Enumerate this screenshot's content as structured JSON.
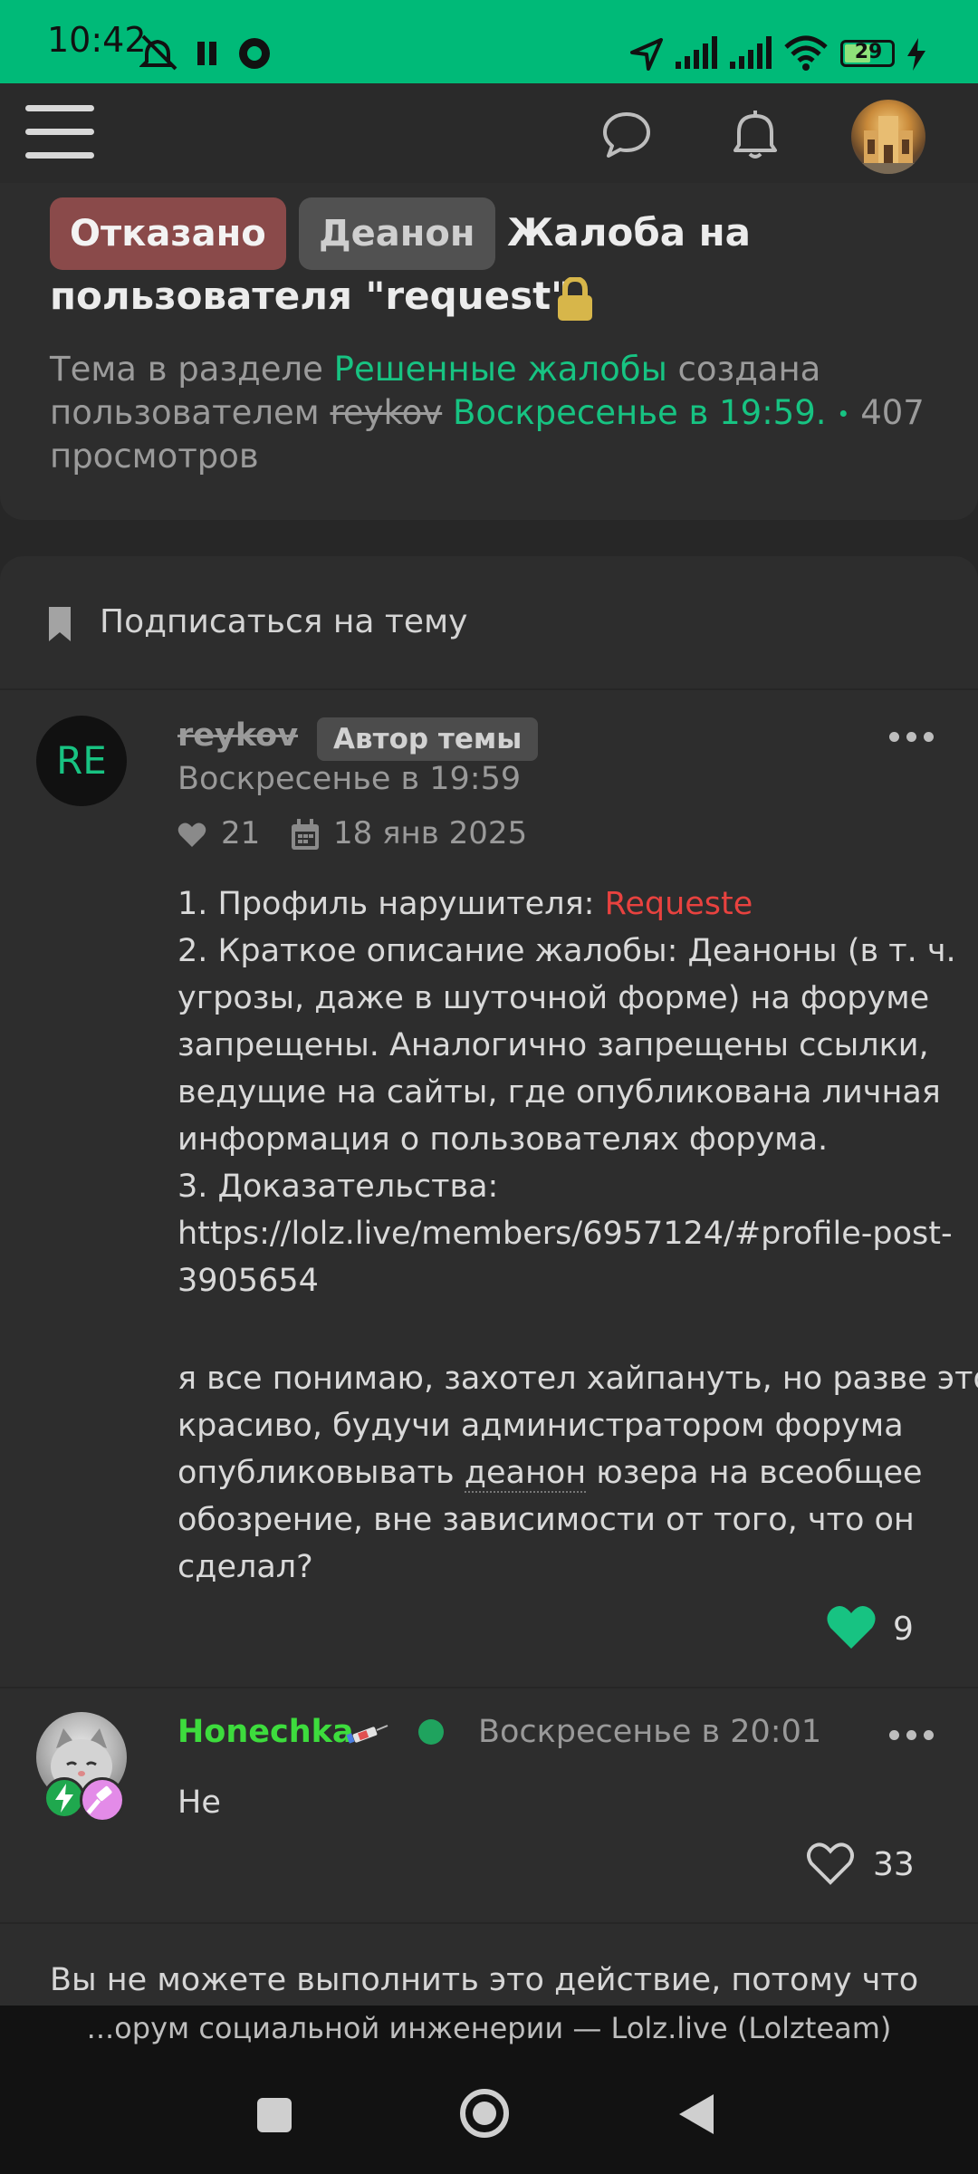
{
  "status_bar": {
    "time": "10:42",
    "battery": "29",
    "icons": [
      "mute-icon",
      "pause-icon",
      "app-icon",
      "location-icon",
      "signal-icon",
      "signal-icon-2",
      "wifi-icon",
      "battery-icon",
      "charging-icon"
    ]
  },
  "header": {
    "menu_icon": "hamburger-icon",
    "chat_icon": "chat-bubble-icon",
    "bell_icon": "bell-icon"
  },
  "thread": {
    "tag_rejected": "Отказано",
    "tag_deanon": "Деанон",
    "title_part1": "Жалоба на",
    "title_part2": "пользователя \"request\"",
    "meta_prefix": "Тема в разделе",
    "meta_section": "Решенные жалобы",
    "meta_created": "создана",
    "meta_by": "пользователем",
    "meta_author": "reykov",
    "meta_date": "Воскресенье в 19:59.",
    "meta_dot": "•",
    "meta_views": "407",
    "meta_views_label": "просмотров"
  },
  "subscribe": {
    "label": "Подписаться на тему"
  },
  "posts": [
    {
      "avatar_text": "RE",
      "author": "reykov",
      "badge": "Автор темы",
      "time": "Воскресенье в 19:59",
      "likes_stat": "21",
      "join_date": "18 янв 2025",
      "line1_label": "1. Профиль нарушителя:",
      "line1_link": "Requeste",
      "line2": "2. Краткое описание жалобы: Деаноны (в т. ч.",
      "line3": "угрозы, даже в шуточной форме) на форуме",
      "line4": "запрещены. Аналогично запрещены ссылки,",
      "line5": "ведущие на сайты, где опубликована личная",
      "line6": "информация о пользователях форума.",
      "line7": "3. Доказательства:",
      "link1": "https://lolz.live/members/6957124/#profile-post-",
      "link2": "3905654",
      "para1": "я все понимаю, захотел хайпануть, но разве это",
      "para2": "красиво, будучи администратором форума",
      "para3_a": "опубликовывать",
      "para3_b": "деанон",
      "para3_c": "юзера на всеобщее",
      "para4": "обозрение, вне зависимости от того, что он",
      "para5": "сделал?",
      "likes": "9"
    },
    {
      "author": "Honechka",
      "time": "Воскресенье в 20:01",
      "text": "Не",
      "likes": "33"
    }
  ],
  "notice": "Вы не можете выполнить это действие, потому что",
  "bottom_url": "...орум социальной инженерии — Lolz.live (Lolzteam)",
  "nav": {
    "recent": "square-icon",
    "home": "circle-icon",
    "back": "triangle-back-icon"
  },
  "colors": {
    "status_bar": "#00ba78",
    "accent_green": "#17c382",
    "link_red": "#e8423f",
    "honechka_green": "#3ddc3d",
    "tag_red": "#8a4a4a"
  }
}
